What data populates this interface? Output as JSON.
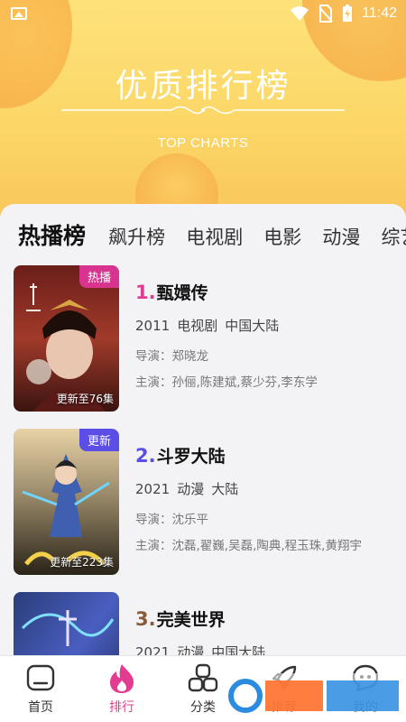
{
  "status_bar": {
    "time": "11:42"
  },
  "hero": {
    "title": "优质排行榜",
    "subtitle": "TOP CHARTS"
  },
  "tabs": [
    {
      "label": "热播榜",
      "active": true
    },
    {
      "label": "飙升榜"
    },
    {
      "label": "电视剧"
    },
    {
      "label": "电影"
    },
    {
      "label": "动漫"
    },
    {
      "label": "综艺"
    }
  ],
  "items": [
    {
      "rank": "1.",
      "title": "甄嬛传",
      "year": "2011",
      "type": "电视剧",
      "region": "中国大陆",
      "director": "导演：郑晓龙",
      "cast": "主演：孙俪,陈建斌,蔡少芬,李东学",
      "badge": "热播",
      "episodes": "更新至76集",
      "rank_color": "#e33b8f"
    },
    {
      "rank": "2.",
      "title": "斗罗大陆",
      "year": "2021",
      "type": "动漫",
      "region": "大陆",
      "director": "导演：沈乐平",
      "cast": "主演：沈磊,翟巍,吴磊,陶典,程玉珠,黄翔宇",
      "badge": "更新",
      "episodes": "更新至223集",
      "rank_color": "#5a4ee6"
    },
    {
      "rank": "3.",
      "title": "完美世界",
      "year": "2021",
      "type": "动漫",
      "region": "中国大陆",
      "rank_color": "#8a5a3a"
    }
  ],
  "bottom_nav": [
    {
      "label": "首页",
      "icon": "home-icon"
    },
    {
      "label": "排行",
      "icon": "flame-icon",
      "active": true
    },
    {
      "label": "分类",
      "icon": "grid-icon"
    },
    {
      "label": "推荐",
      "icon": "rocket-icon"
    },
    {
      "label": "我的",
      "icon": "chat-icon"
    }
  ],
  "colors": {
    "accent": "#e33b8f",
    "hero": "#fcd768",
    "badge_hot": "#d8348f",
    "badge_new": "#5a4ee6"
  }
}
